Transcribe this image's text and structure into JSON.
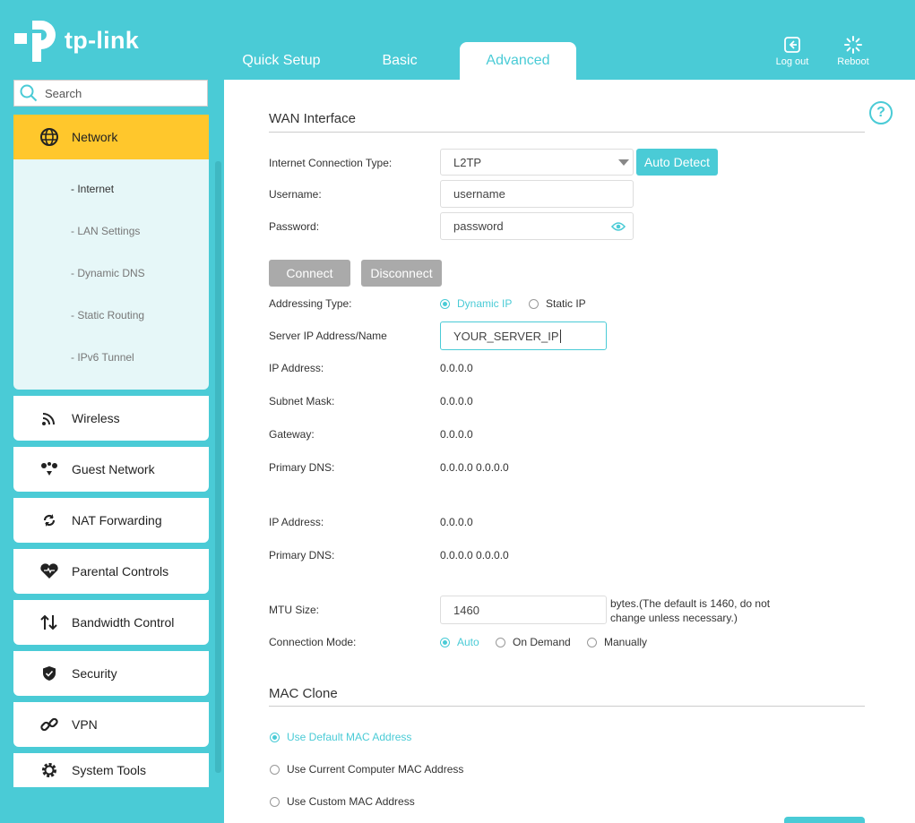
{
  "brand": {
    "logo_text": "tp-link"
  },
  "tabs": [
    {
      "label": "Quick Setup"
    },
    {
      "label": "Basic"
    },
    {
      "label": "Advanced"
    }
  ],
  "top_actions": {
    "logout": "Log out",
    "reboot": "Reboot"
  },
  "search": {
    "placeholder": "Search"
  },
  "sidebar": {
    "network": "Network",
    "sub_items": [
      "- Internet",
      "- LAN Settings",
      "- Dynamic DNS",
      "- Static Routing",
      "- IPv6 Tunnel"
    ],
    "items": [
      "Wireless",
      "Guest Network",
      "NAT Forwarding",
      "Parental Controls",
      "Bandwidth Control",
      "Security",
      "VPN",
      "System Tools"
    ]
  },
  "wan": {
    "title": "WAN Interface",
    "conn_type_label": "Internet Connection Type:",
    "conn_type_value": "L2TP",
    "auto_detect": "Auto Detect",
    "username_label": "Username:",
    "username_value": "username",
    "password_label": "Password:",
    "password_value": "password",
    "connect": "Connect",
    "disconnect": "Disconnect",
    "addressing_label": "Addressing Type:",
    "dynamic_ip": "Dynamic IP",
    "static_ip": "Static IP",
    "server_label": "Server IP Address/Name",
    "server_value": "YOUR_SERVER_IP",
    "ip_label": "IP Address:",
    "ip_value": "0.0.0.0",
    "subnet_label": "Subnet Mask:",
    "subnet_value": "0.0.0.0",
    "gateway_label": "Gateway:",
    "gateway_value": "0.0.0.0",
    "dns_label": "Primary DNS:",
    "dns_value": "0.0.0.0 0.0.0.0",
    "ip2_label": "IP Address:",
    "ip2_value": "0.0.0.0",
    "dns2_label": "Primary DNS:",
    "dns2_value": "0.0.0.0 0.0.0.0",
    "mtu_label": "MTU Size:",
    "mtu_value": "1460",
    "mtu_note_1": "bytes.(The default is 1460, do not",
    "mtu_note_2": "change unless necessary.)",
    "conn_mode_label": "Connection Mode:",
    "mode_auto": "Auto",
    "mode_on_demand": "On Demand",
    "mode_manually": "Manually"
  },
  "mac": {
    "title": "MAC Clone",
    "default": "Use Default MAC Address",
    "current": "Use Current Computer MAC Address",
    "custom": "Use Custom MAC Address"
  },
  "help_icon": "?",
  "colors": {
    "accent": "#4acbd6",
    "active_nav": "#ffc72c",
    "subpanel": "#e6f7f8"
  }
}
